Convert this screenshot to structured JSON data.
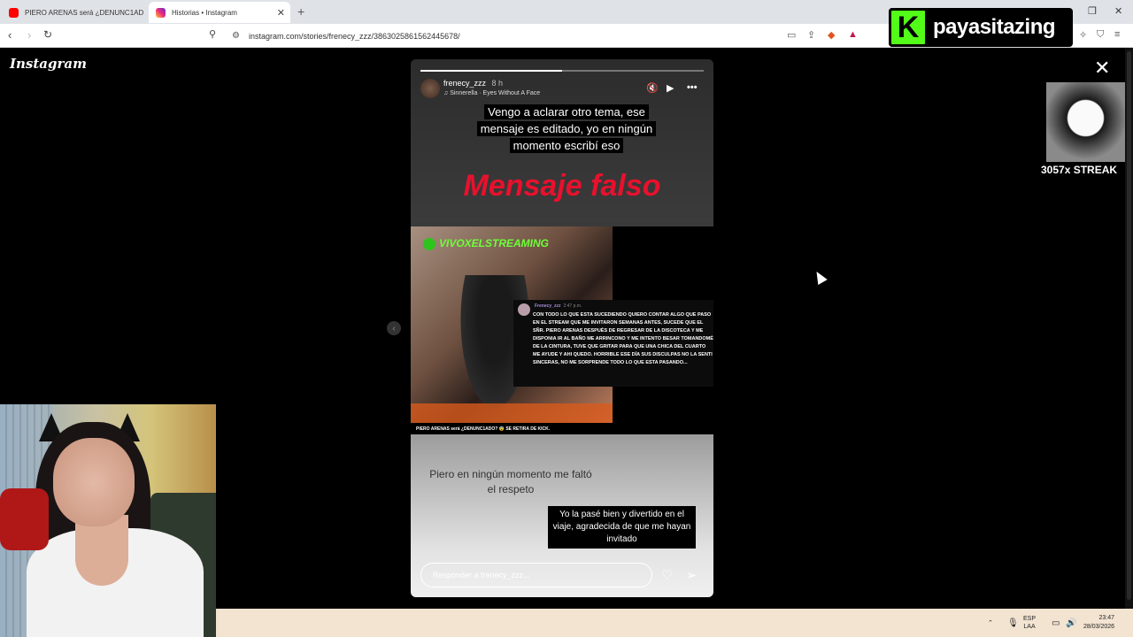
{
  "browser": {
    "tabs": [
      {
        "title": "PIERO ARENAS será ¿DENUNC1AD",
        "favicon_color": "#ff0000",
        "active": false
      },
      {
        "title": "Historias • Instagram",
        "favicon_color": "#d6249f",
        "active": true
      }
    ],
    "new_tab": "+",
    "url": "instagram.com/stories/frenecy_zzz/3863025861562445678/"
  },
  "overlay": {
    "channel_name": "payasitazing",
    "streak_text": "3057x STREAK"
  },
  "instagram": {
    "logo": "Instagram",
    "story": {
      "username": "frenecy_zzz",
      "time_ago": "8 h",
      "song": "Sinnerella · Eyes Without A Face",
      "caption_top": "Vengo a aclarar otro tema, ese mensaje es editado, yo en ningún momento escribí eso",
      "fake_label": "Mensaje falso",
      "clip": {
        "channel": "VIVOXELSTREAMING",
        "chat_user": "Frenecy_zzz",
        "chat_time": "2:47 p.m.",
        "chat_message": "CON TODO LO QUE ESTA SUCEDIENDO QUIERO CONTAR ALGO QUE PASO EN EL STREAM QUE ME INVITARON SEMANAS ANTES, SUCEDE QUE EL SÑR. PIERO ARENAS DESPUÉS DE REGRESAR DE LA DISCOTECA Y ME DISPONIA IR AL BAÑO ME ARRINCONO Y ME INTENTO BESAR TOMANDOMÉ DE LA CINTURA, TUVE QUE GRITAR PARA QUE UNA CHICA DEL CUARTO ME AYUDE Y AHI QUEDO. HORRIBLE ESE DÍA SUS DISCULPAS NO LA SENTI SINCERAS, NO ME SORPRENDE TODO LO QUE ESTA PASANDO...",
        "ticker": "PIERO ARENAS será ¿DENUNC1ADO? 😨 SE RETIRA DE KICK."
      },
      "bottom_text_1": "Piero en ningún momento me faltó el respeto",
      "bottom_text_2": "Yo la pasé bien y divertido en el viaje, agradecida de que me hayan invitado",
      "reply_placeholder": "Responder a frenecy_zzz...",
      "progress_done_fraction": 0.5
    }
  },
  "taskbar": {
    "lang_top": "ESP",
    "lang_bottom": "LAA",
    "time": "23:47",
    "date": "28/03/2026"
  }
}
